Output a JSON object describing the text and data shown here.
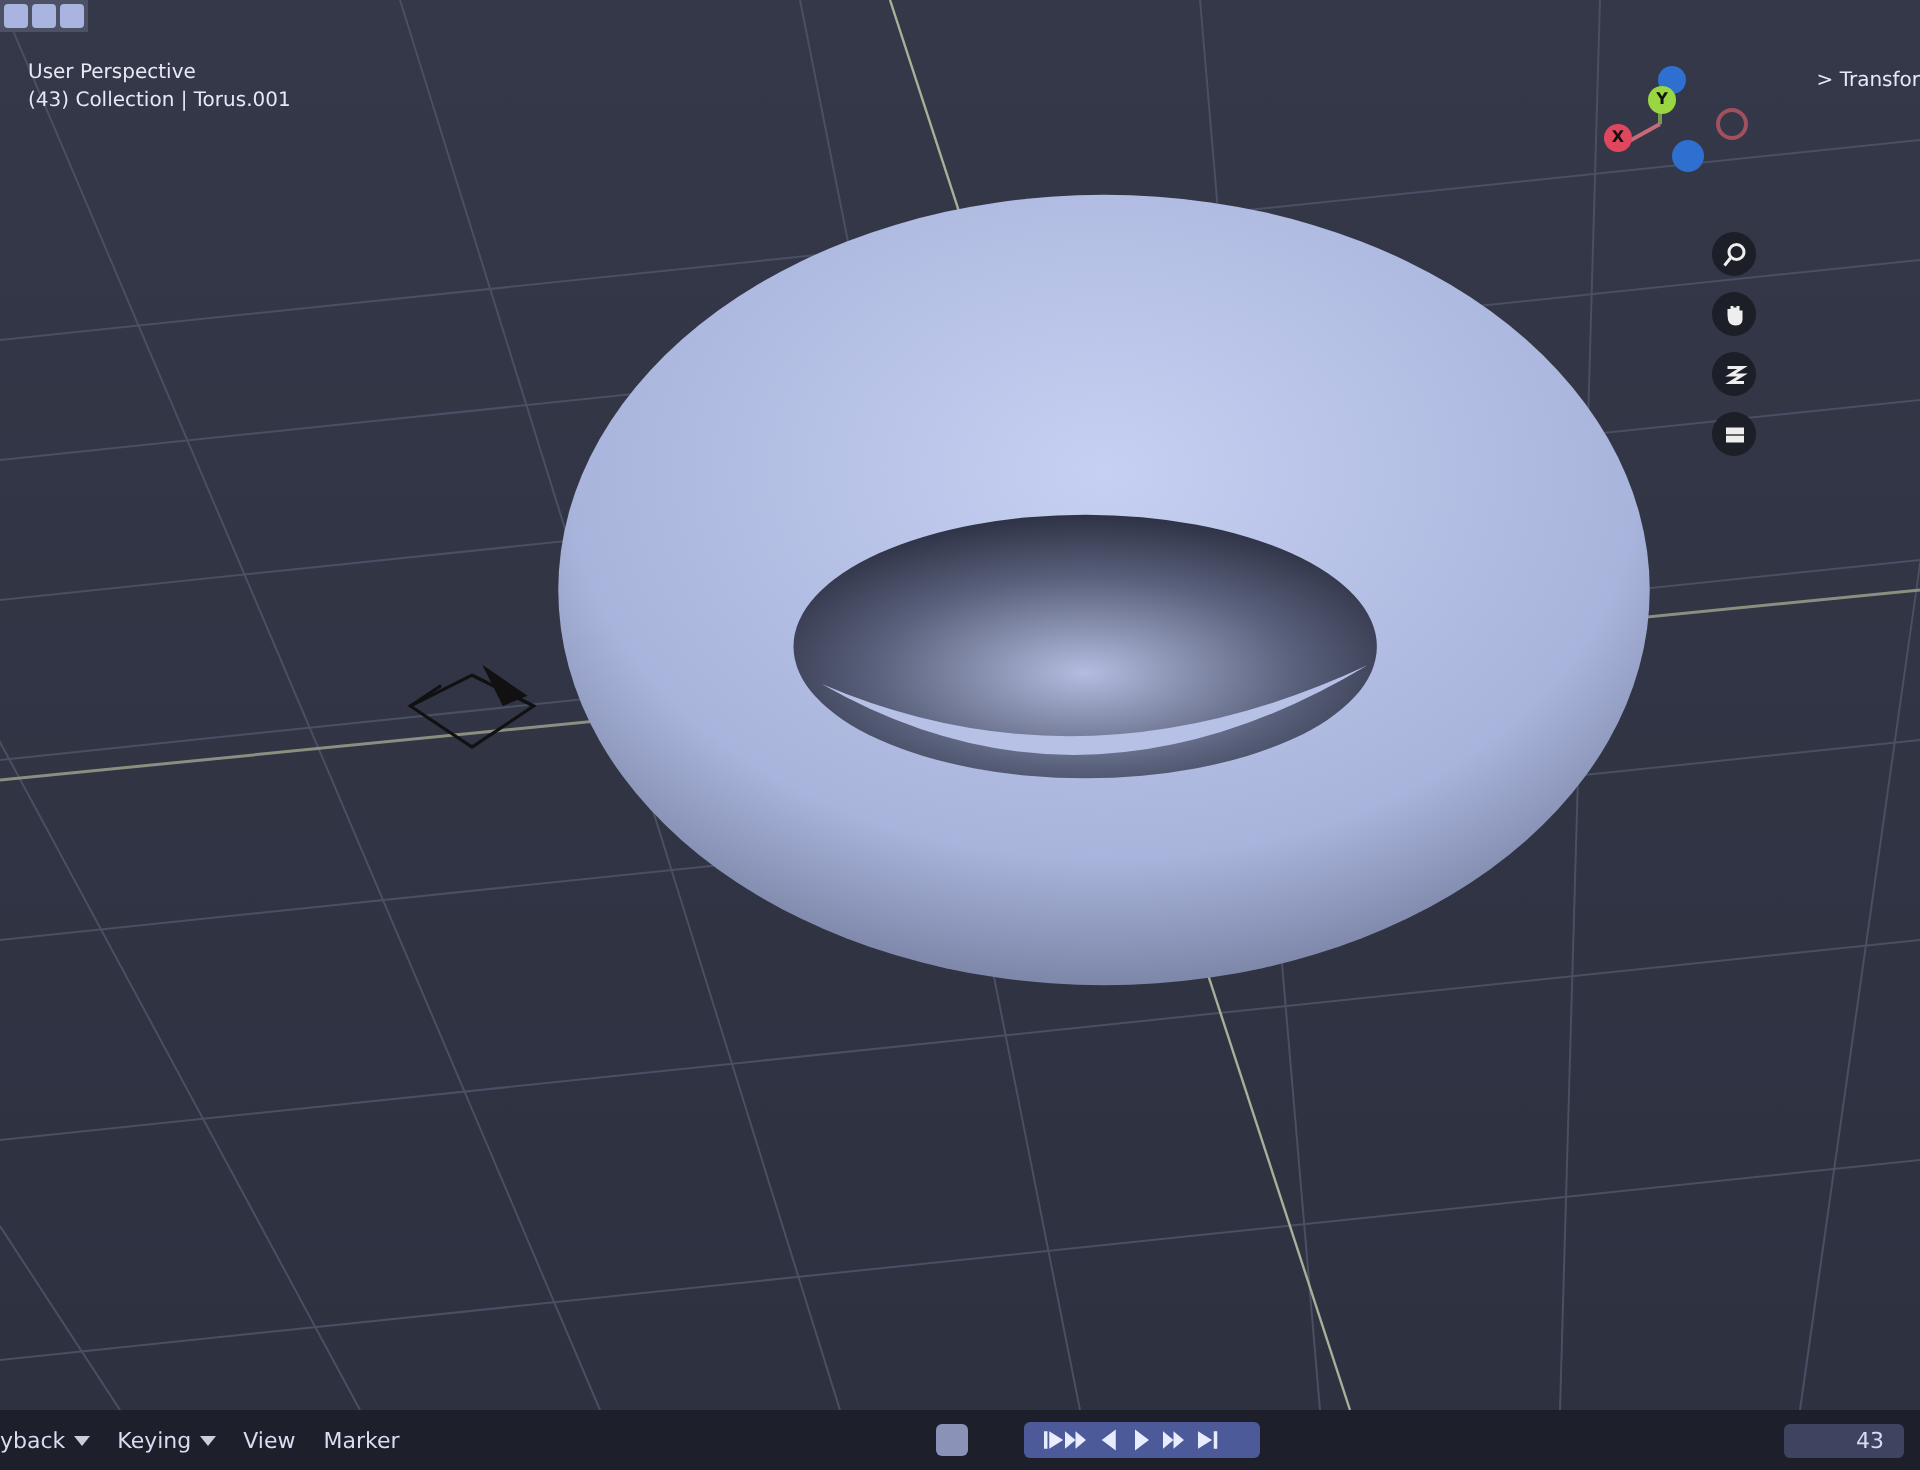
{
  "viewport": {
    "title": "User Perspective",
    "context": "(43) Collection | Torus.001"
  },
  "sidebar_tab": {
    "arrow": ">",
    "label": "Transfor"
  },
  "gizmo": {
    "axes": [
      {
        "label": "X",
        "color": "#e0475e"
      },
      {
        "label": "Y",
        "color": "#9ad641"
      }
    ]
  },
  "timeline": {
    "menus": [
      {
        "label": "yback",
        "dropdown": true
      },
      {
        "label": "Keying",
        "dropdown": true
      },
      {
        "label": "View",
        "dropdown": false
      },
      {
        "label": "Marker",
        "dropdown": false
      }
    ],
    "frame": "43"
  }
}
